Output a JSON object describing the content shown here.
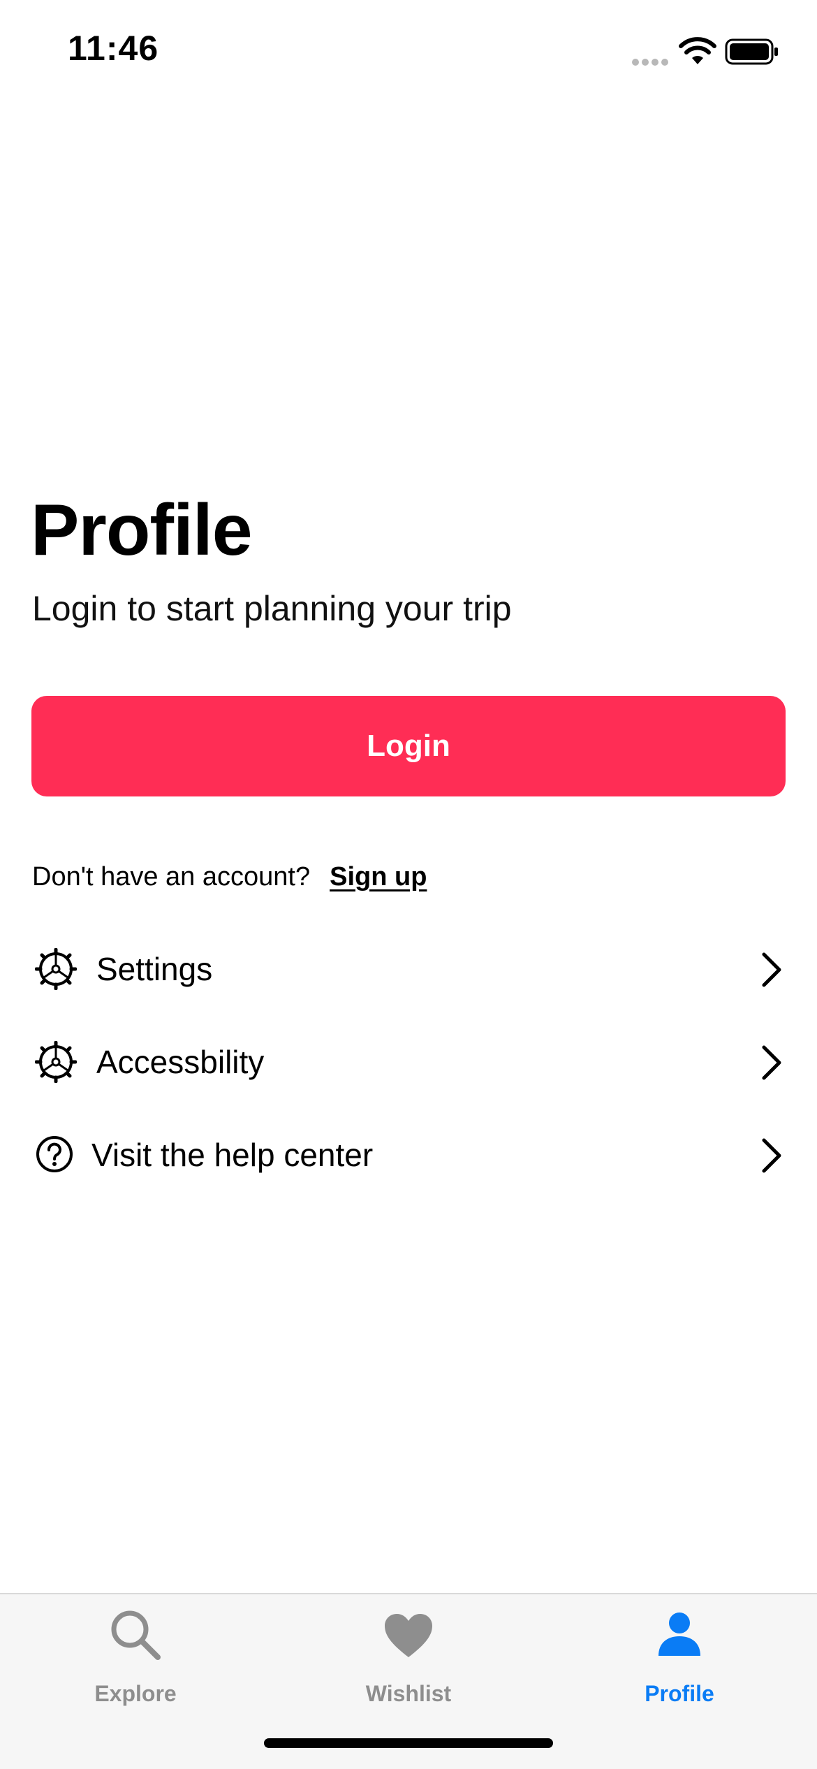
{
  "status_bar": {
    "time": "11:46"
  },
  "header": {
    "title": "Profile",
    "subtitle": "Login to start planning your trip"
  },
  "login": {
    "button_label": "Login",
    "color": "#ff2d55"
  },
  "signup": {
    "prompt": "Don't have an account?",
    "link_label": "Sign up"
  },
  "menu": {
    "items": [
      {
        "label": "Settings",
        "icon": "gear-icon"
      },
      {
        "label": "Accessbility",
        "icon": "gear-icon"
      },
      {
        "label": "Visit the help center",
        "icon": "question-circle-icon"
      }
    ]
  },
  "tab_bar": {
    "active_color": "#0a7cf5",
    "inactive_color": "#8e8e8e",
    "tabs": [
      {
        "label": "Explore",
        "icon": "search-icon",
        "active": false
      },
      {
        "label": "Wishlist",
        "icon": "heart-icon",
        "active": false
      },
      {
        "label": "Profile",
        "icon": "person-icon",
        "active": true
      }
    ]
  }
}
